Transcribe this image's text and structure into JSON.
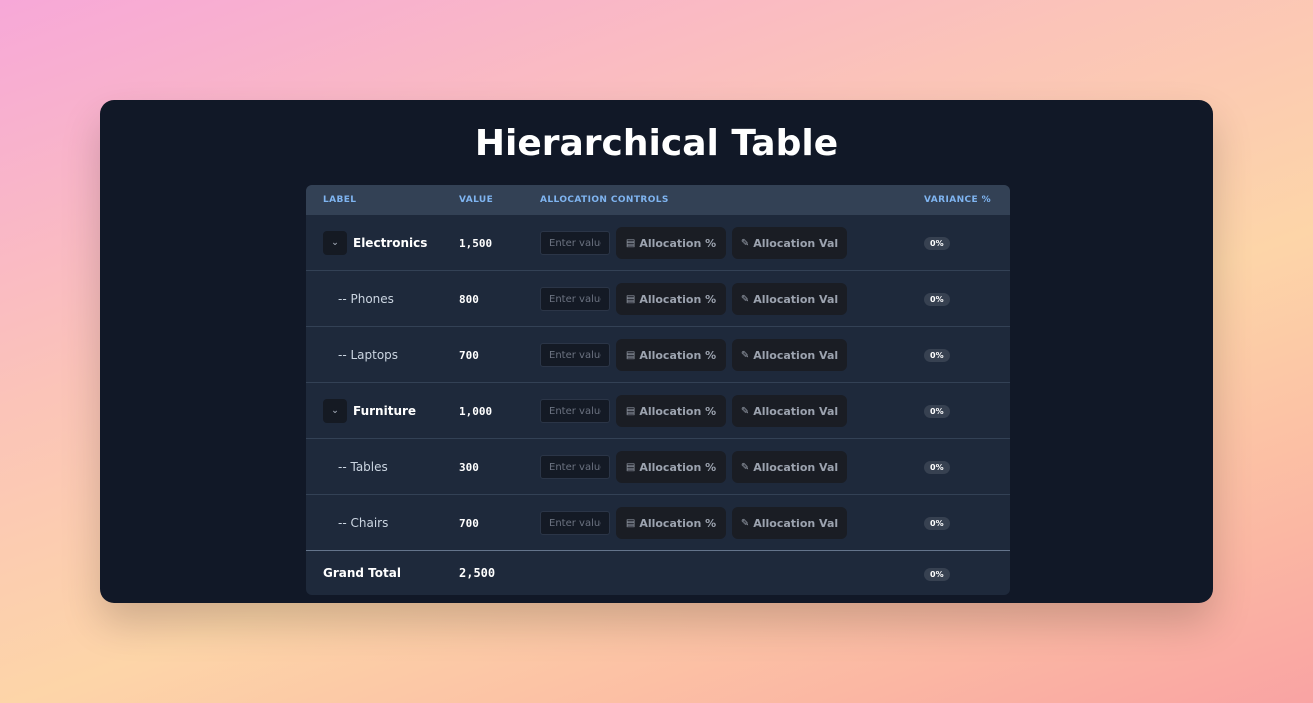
{
  "title": "Hierarchical Table",
  "columns": {
    "label": "Label",
    "value": "Value",
    "allocation": "Allocation Controls",
    "variance": "Variance %"
  },
  "rows": [
    {
      "label": "Electronics",
      "value": "1,500",
      "type": "parent",
      "variance": "0%"
    },
    {
      "label": "-- Phones",
      "value": "800",
      "type": "child",
      "variance": "0%"
    },
    {
      "label": "-- Laptops",
      "value": "700",
      "type": "child",
      "variance": "0%"
    },
    {
      "label": "Furniture",
      "value": "1,000",
      "type": "parent",
      "variance": "0%"
    },
    {
      "label": "-- Tables",
      "value": "300",
      "type": "child",
      "variance": "0%"
    },
    {
      "label": "-- Chairs",
      "value": "700",
      "type": "child",
      "variance": "0%"
    }
  ],
  "controls": {
    "input_placeholder": "Enter value",
    "alloc_pct_label": "Allocation %",
    "alloc_val_label": "Allocation Val",
    "alloc_pct_icon": "calculator-icon",
    "alloc_val_icon": "edit-icon",
    "expand_icon": "chevron-down-icon"
  },
  "grand_total": {
    "label": "Grand Total",
    "value": "2,500",
    "variance": "0%"
  }
}
